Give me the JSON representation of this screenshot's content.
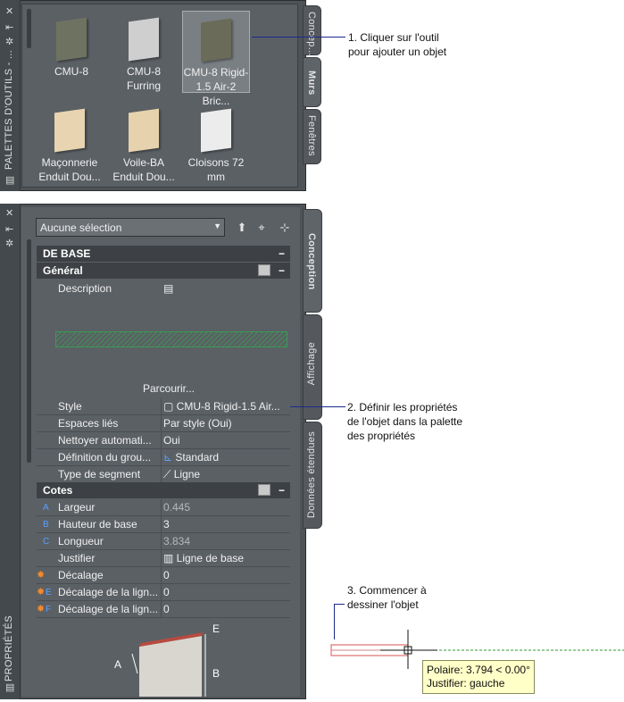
{
  "tool_palette": {
    "title_vertical": "PALETTES D'OUTILS - ...",
    "tools": [
      {
        "label": "CMU-8",
        "color": "#6e7260"
      },
      {
        "label": "CMU-8 Furring",
        "color": "#cfcfcf"
      },
      {
        "label": "CMU-8 Rigid-1.5 Air-2 Bric...",
        "color": "#6a6b58",
        "selected": true
      },
      {
        "label": "Maçonnerie Enduit Dou...",
        "color": "#e8d4b0"
      },
      {
        "label": "Voile-BA Enduit Dou...",
        "color": "#e6d2ad"
      },
      {
        "label": "Cloisons 72 mm",
        "color": "#ececec"
      }
    ],
    "tabs": [
      "Concep...",
      "Murs",
      "Fenêtres"
    ]
  },
  "properties": {
    "title_vertical": "PROPRIÉTÉS",
    "selection_dropdown": "Aucune sélection",
    "tabs": [
      "Conception",
      "Affichage",
      "Données étendues"
    ],
    "sections": {
      "base": "DE BASE",
      "general": "Général",
      "cotes": "Cotes"
    },
    "general_rows": {
      "description": "Description",
      "browse": "Parcourir...",
      "style_label": "Style",
      "style_value": "CMU-8 Rigid-1.5 Air...",
      "espaces_label": "Espaces liés",
      "espaces_value": "Par style (Oui)",
      "nettoyer_label": "Nettoyer automati...",
      "nettoyer_value": "Oui",
      "definition_label": "Définition du grou...",
      "definition_value": "Standard",
      "segment_label": "Type de segment",
      "segment_value": "Ligne"
    },
    "cotes_rows": [
      {
        "letter": "A",
        "label": "Largeur",
        "value": "0.445",
        "dim": true
      },
      {
        "letter": "B",
        "label": "Hauteur de base",
        "value": "3",
        "dim": false
      },
      {
        "letter": "C",
        "label": "Longueur",
        "value": "3.834",
        "dim": true
      },
      {
        "letter": "",
        "label": "Justifier",
        "value": "Ligne de base",
        "dim": false
      },
      {
        "letter": "",
        "label": "Décalage",
        "value": "0",
        "dim": false,
        "spark": true
      },
      {
        "letter": "E",
        "label": "Décalage de la lign...",
        "value": "0",
        "dim": false,
        "spark": true
      },
      {
        "letter": "F",
        "label": "Décalage de la lign...",
        "value": "0",
        "dim": false,
        "spark": true
      }
    ],
    "diagram_letters": {
      "a": "A",
      "e": "E",
      "b": "B"
    }
  },
  "callouts": {
    "c1_line1": "1. Cliquer sur l'outil",
    "c1_line2": "pour ajouter un objet",
    "c2_line1": "2. Définir les propriétés",
    "c2_line2": "de l'objet dans la palette",
    "c2_line3": "des propriétés",
    "c3_line1": "3. Commencer à",
    "c3_line2": "dessiner l'objet"
  },
  "tooltip": {
    "line1": "Polaire: 3.794 < 0.00°",
    "line2": "Justifier: gauche"
  },
  "colors": {
    "callout_line": "#1b2a8a",
    "tooltip_bg": "#ffffc8",
    "wall_outline": "#d9534f",
    "tracking_line": "#2e9b2e"
  }
}
